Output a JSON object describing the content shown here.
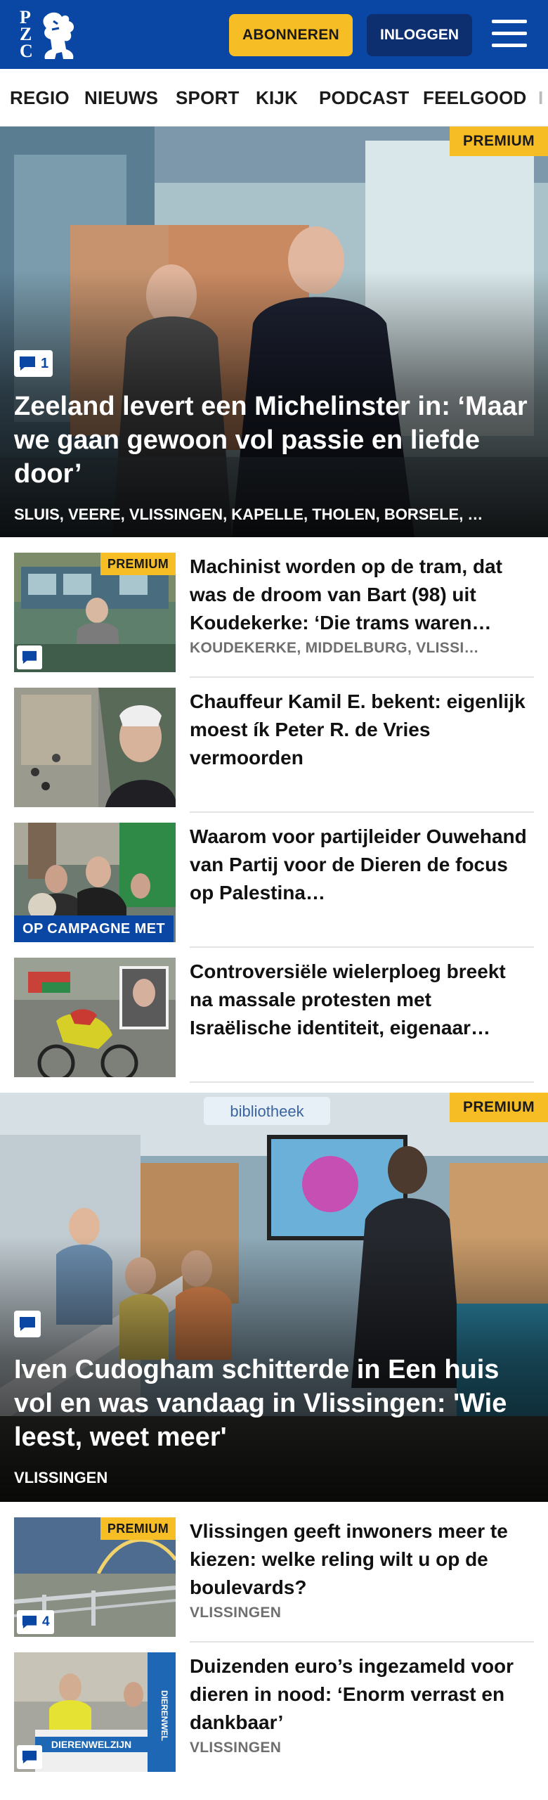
{
  "header": {
    "logo_letters": [
      "P",
      "Z",
      "C"
    ],
    "subscribe_label": "ABONNEREN",
    "login_label": "INLOGGEN",
    "brand_color": "#0a47a5",
    "accent_color": "#f7bd24"
  },
  "nav": {
    "items": [
      {
        "label": "REGIO"
      },
      {
        "label": "NIEUWS"
      },
      {
        "label": "SPORT"
      },
      {
        "label": "KIJK"
      },
      {
        "label": "PODCAST"
      },
      {
        "label": "FEELGOOD"
      },
      {
        "label": "I"
      }
    ]
  },
  "hero1": {
    "premium": "PREMIUM",
    "comment_count": "1",
    "title": "Zeeland levert een Michelinster in: ‘Maar we gaan gewoon vol passie en liefde door’",
    "tags": "SLUIS, VEERE, VLISSINGEN, KAPELLE, THOLEN, BORSELE, …"
  },
  "list1": [
    {
      "premium": "PREMIUM",
      "title": "Machinist worden op de tram, dat was de droom van Bart (98) uit Koudekerke: ‘Die trams waren…",
      "tags": "KOUDEKERKE, MIDDELBURG, VLISSI…"
    },
    {
      "title": "Chauffeur Kamil E. bekent: eigenlijk moest ík Peter R. de Vries vermoorden"
    },
    {
      "label": "OP CAMPAGNE MET",
      "title": "Waarom voor partijleider Ouwehand van Partij voor de Dieren de focus op Palestina…"
    },
    {
      "title": "Controversiële wielerploeg breekt na massale protesten met Israëlische identiteit, eigenaar…"
    }
  ],
  "hero2": {
    "premium": "PREMIUM",
    "title": "Iven Cudogham schitterde in Een huis vol en was vandaag in Vlissingen: 'Wie leest, weet meer'",
    "tags": "VLISSINGEN",
    "sign_text": "bibliotheek"
  },
  "list2": [
    {
      "premium": "PREMIUM",
      "comment_count": "4",
      "title": "Vlissingen geeft inwoners meer te kiezen: welke reling wilt u op de boulevards?",
      "tags": "VLISSINGEN"
    },
    {
      "title": "Duizenden euro’s ingezameld voor dieren in nood: ‘Enorm verrast en dankbaar’",
      "tags": "VLISSINGEN",
      "banner_text": "DIERENWELZIJN",
      "side_text": "DIERENWEL"
    }
  ],
  "icons": {
    "comment": "speech-bubble-icon",
    "menu": "hamburger-menu-icon",
    "logo": "lion-logo-icon"
  }
}
